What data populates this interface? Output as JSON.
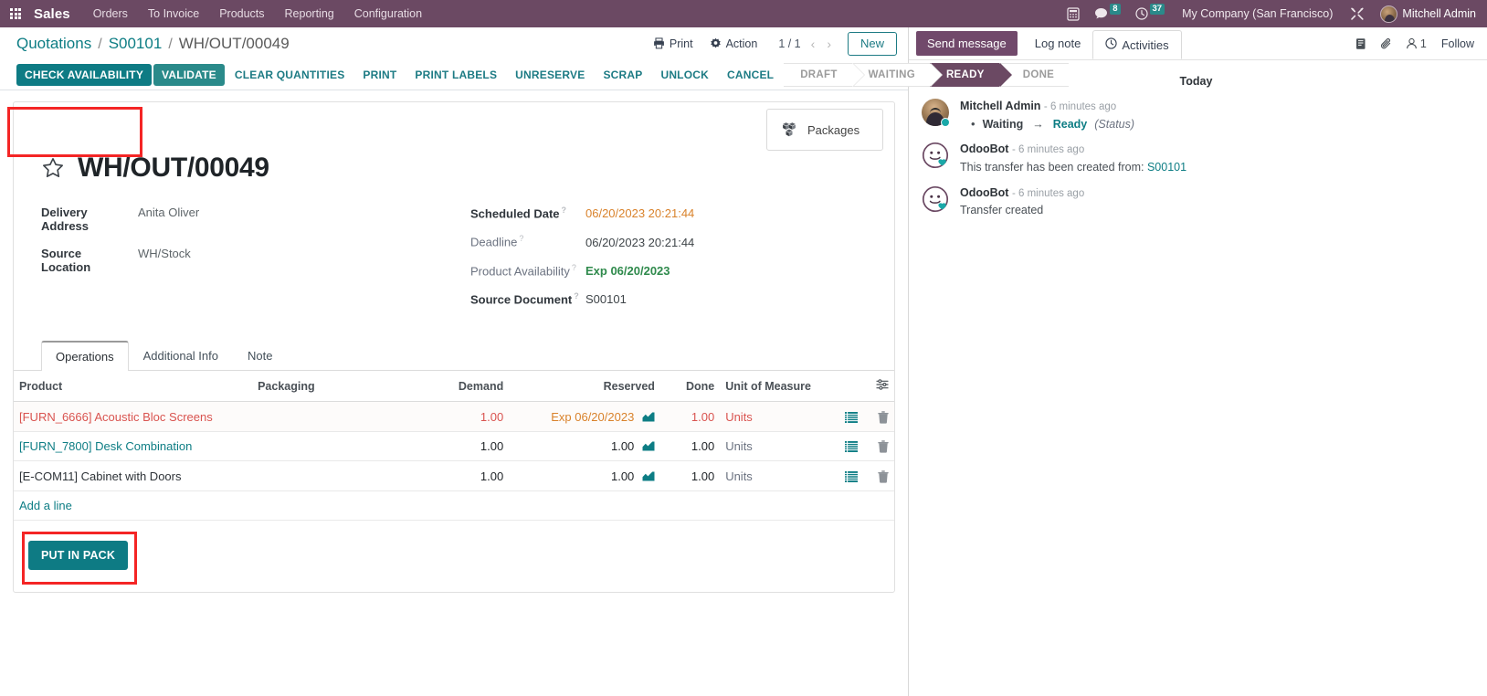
{
  "navbar": {
    "apps_icon": "grid-apps-icon",
    "brand": "Sales",
    "menus": [
      "Orders",
      "To Invoice",
      "Products",
      "Reporting",
      "Configuration"
    ],
    "sys": [
      {
        "icon": "phone-keypad-icon",
        "count": ""
      },
      {
        "icon": "messages-icon",
        "count": "8"
      },
      {
        "icon": "activities-clock-icon",
        "count": "37"
      }
    ],
    "company": "My Company (San Francisco)",
    "debug_icon": "tools-wrench-icon",
    "user": "Mitchell Admin",
    "bg_color": "#6b4963",
    "badge_color": "#2a8a8a"
  },
  "control_panel": {
    "breadcrumb": [
      {
        "label": "Quotations",
        "link": true
      },
      {
        "label": "S00101",
        "link": true
      },
      {
        "label": "WH/OUT/00049",
        "link": false
      }
    ],
    "print_label": "Print",
    "action_label": "Action",
    "pager": "1 / 1",
    "prev_icon": "chevron-left-icon",
    "next_icon": "chevron-right-icon",
    "new_label": "New",
    "buttons": [
      {
        "label": "CHECK AVAILABILITY",
        "style": "primary"
      },
      {
        "label": "VALIDATE",
        "style": "secondary"
      },
      {
        "label": "CLEAR QUANTITIES",
        "style": "link"
      },
      {
        "label": "PRINT",
        "style": "link"
      },
      {
        "label": "PRINT LABELS",
        "style": "link"
      },
      {
        "label": "UNRESERVE",
        "style": "link"
      },
      {
        "label": "SCRAP",
        "style": "link"
      },
      {
        "label": "UNLOCK",
        "style": "link"
      },
      {
        "label": "CANCEL",
        "style": "link"
      }
    ],
    "statuses": [
      {
        "label": "DRAFT",
        "active": false
      },
      {
        "label": "WAITING",
        "active": false
      },
      {
        "label": "READY",
        "active": true
      },
      {
        "label": "DONE",
        "active": false
      }
    ]
  },
  "sheet": {
    "smart_button": {
      "label": "Packages",
      "icon": "packages-boxes-icon",
      "highlighted": true
    },
    "star_icon": "star-favorite-icon",
    "title": "WH/OUT/00049",
    "left_fields": [
      {
        "label": "Delivery Address",
        "value": "Anita Oliver",
        "bold_label": true
      },
      {
        "label": "Source Location",
        "value": "WH/Stock",
        "bold_label": true
      }
    ],
    "right_fields": [
      {
        "label": "Scheduled Date",
        "value": "06/20/2023 20:21:44",
        "help": "?",
        "bold_label": true,
        "color": "orange"
      },
      {
        "label": "Deadline",
        "value": "06/20/2023 20:21:44",
        "help": "?",
        "bold_label": false,
        "color": "dark"
      },
      {
        "label": "Product Availability",
        "value": "Exp 06/20/2023",
        "help": "?",
        "bold_label": false,
        "color": "green"
      },
      {
        "label": "Source Document",
        "value": "S00101",
        "help": "?",
        "bold_label": true,
        "color": "dark"
      }
    ]
  },
  "notebook": {
    "tabs": [
      {
        "label": "Operations",
        "active": true
      },
      {
        "label": "Additional Info",
        "active": false
      },
      {
        "label": "Note",
        "active": false
      }
    ],
    "optional_columns_icon": "column-settings-icon",
    "columns": [
      "Product",
      "Packaging",
      "Demand",
      "Reserved",
      "Done",
      "Unit of Measure"
    ],
    "rows": [
      {
        "product": "[FURN_6666] Acoustic Bloc Screens",
        "packaging": "",
        "demand": "1.00",
        "reserved": "Exp 06/20/2023",
        "reserved_icon": "forecast-report-icon",
        "done": "1.00",
        "uom": "Units",
        "state": "warning",
        "list_icon": "line-details-icon",
        "delete_icon": "trash-icon"
      },
      {
        "product": "[FURN_7800] Desk Combination",
        "packaging": "",
        "demand": "1.00",
        "reserved": "1.00",
        "reserved_icon": "forecast-report-icon",
        "done": "1.00",
        "uom": "Units",
        "state": "link",
        "list_icon": "line-details-icon",
        "delete_icon": "trash-icon"
      },
      {
        "product": "[E-COM11] Cabinet with Doors",
        "packaging": "",
        "demand": "1.00",
        "reserved": "1.00",
        "reserved_icon": "forecast-report-icon",
        "done": "1.00",
        "uom": "Units",
        "state": "plain",
        "list_icon": "line-details-icon",
        "delete_icon": "trash-icon"
      }
    ],
    "add_line": "Add a line",
    "put_in_pack": {
      "label": "PUT IN PACK",
      "highlighted": true
    }
  },
  "chatter": {
    "send_message": "Send message",
    "log_note": "Log note",
    "activities": "Activities",
    "activities_icon": "clock-icon",
    "attach_icon": "paperclip-icon",
    "print_icon": "document-icon",
    "followers_icon": "user-follower-icon",
    "followers_count": "1",
    "follow_label": "Follow",
    "day_separator": "Today",
    "messages": [
      {
        "author": "Mitchell Admin",
        "time": "- 6 minutes ago",
        "avatar": "photo",
        "tracking": {
          "bullet": "•",
          "old_value": "Waiting",
          "arrow": "→",
          "new_value": "Ready",
          "field": "(Status)"
        }
      },
      {
        "author": "OdooBot",
        "time": "- 6 minutes ago",
        "avatar": "bot",
        "body_prefix": "This transfer has been created from: ",
        "body_link": "S00101"
      },
      {
        "author": "OdooBot",
        "time": "- 6 minutes ago",
        "avatar": "bot",
        "body_prefix": "Transfer created",
        "body_link": ""
      }
    ]
  },
  "colors": {
    "brand_purple": "#6b4963",
    "teal": "#0e7b84",
    "link_teal": "#0d7d84",
    "warning_orange": "#d9822b",
    "danger_red": "#d9534f",
    "success_green": "#2f8a4c",
    "highlight_red": "#f42525"
  }
}
